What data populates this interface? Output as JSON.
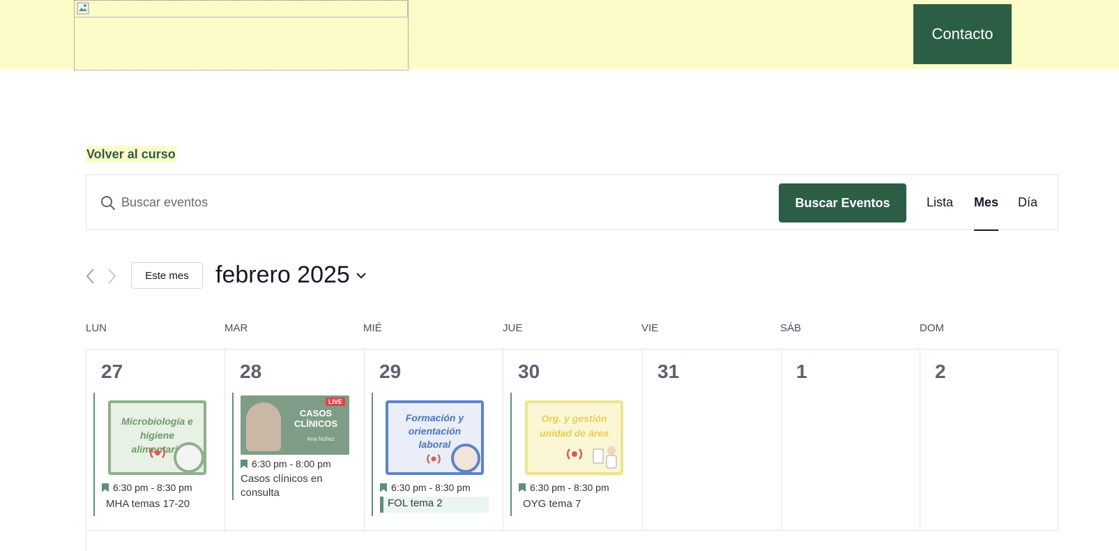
{
  "header": {
    "contact_label": "Contacto"
  },
  "back_link": "Volver al curso",
  "search": {
    "placeholder": "Buscar eventos",
    "button_label": "Buscar Eventos"
  },
  "views": [
    {
      "label": "Lista"
    },
    {
      "label": "Mes",
      "active": true
    },
    {
      "label": "Día"
    }
  ],
  "nav": {
    "today_label": "Este mes",
    "month_label": "febrero 2025"
  },
  "weekdays": [
    "LUN",
    "MAR",
    "MIÉ",
    "JUE",
    "VIE",
    "SÁB",
    "DOM"
  ],
  "days": [
    {
      "num": "27",
      "event": {
        "time": "6:30 pm - 8:30 pm",
        "title": "MHA temas 17-20",
        "thumb_text": "Microbiología e higiene alimentaria"
      }
    },
    {
      "num": "28",
      "event": {
        "time": "6:30 pm - 8:00 pm",
        "title": "Casos clínicos en consulta",
        "thumb_text": "CASOS CLÍNICOS",
        "thumb_sub": "Ana Núñez",
        "thumb_badge": "LIVE"
      }
    },
    {
      "num": "29",
      "event": {
        "time": "6:30 pm - 8:30 pm",
        "title": "FOL tema 2",
        "thumb_text": "Formación y orientación laboral"
      }
    },
    {
      "num": "30",
      "event": {
        "time": "6:30 pm - 8:30 pm",
        "title": "OYG tema 7",
        "thumb_text": "Org. y gestión unidad de área"
      }
    },
    {
      "num": "31"
    },
    {
      "num": "1"
    },
    {
      "num": "2"
    }
  ],
  "colors": {
    "brand_green": "#2c5e45",
    "header_bg": "#fdfbc8",
    "event_accent": "#5f8f76"
  }
}
